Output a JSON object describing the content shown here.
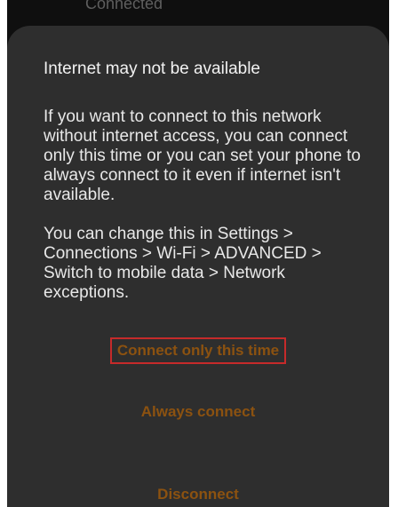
{
  "background": {
    "status_text": "Connected"
  },
  "dialog": {
    "title": "Internet may not be available",
    "paragraph_1": "If you want to connect to this network without internet access, you can connect only this time or you can set your phone to always connect to it even if internet isn't available.",
    "paragraph_2": "You can change this in Settings > Connections > Wi-Fi > ADVANCED > Switch to mobile data > Network exceptions.",
    "buttons": {
      "connect_once": "Connect only this time",
      "always_connect": "Always connect",
      "disconnect": "Disconnect"
    }
  },
  "colors": {
    "dialog_background": "#2e2e2e",
    "button_text": "#8c5210",
    "highlight_outline": "#c62a2a"
  }
}
